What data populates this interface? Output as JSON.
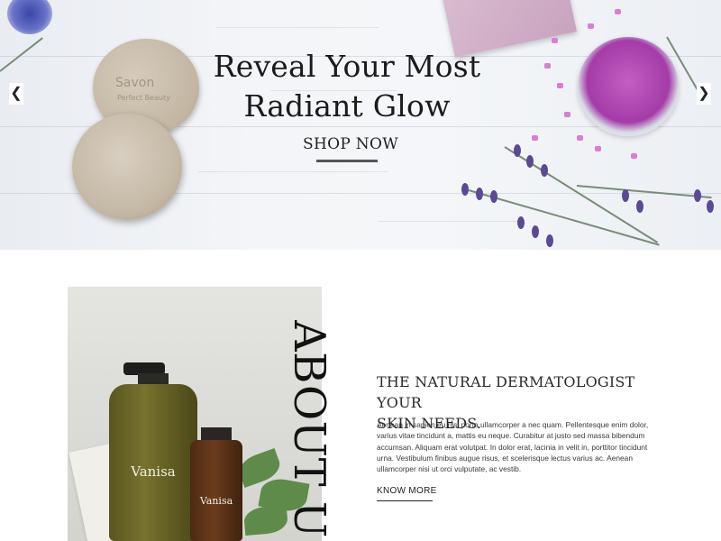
{
  "hero": {
    "title_line1": "Reveal Your Most",
    "title_line2": "Radiant Glow",
    "cta_label": "SHOP NOW",
    "prev_icon": "chevron-left-icon",
    "next_icon": "chevron-right-icon",
    "prev_glyph": "❮",
    "next_glyph": "❯",
    "soap_brand": "Savon",
    "soap_sub": "Perfect Beauty"
  },
  "about": {
    "vertical_title": "ABOUT US",
    "heading_line1": "THE NATURAL DERMATOLOGIST YOUR",
    "heading_line2": "SKIN NEEDS.",
    "body": "Aenean in sapien eu nisi porta ullamcorper a nec quam. Pellentesque enim dolor, varius vitae tincidunt a, mattis eu neque. Curabitur at justo sed massa bibendum accumsan. Aliquam erat volutpat. In dolor erat, lacinia in velit in, porttitor tincidunt urna. Vestibulum finibus augue risus, et scelerisque lectus varius ac. Aenean ullamcorper nisi ut orci vulputate, ac vestib.",
    "cta_label": "KNOW MORE",
    "product_brand_large": "Vanisa",
    "product_brand_small": "Vanisa"
  },
  "colors": {
    "text_dark": "#1b1b1b",
    "accent_underline": "#555555"
  }
}
